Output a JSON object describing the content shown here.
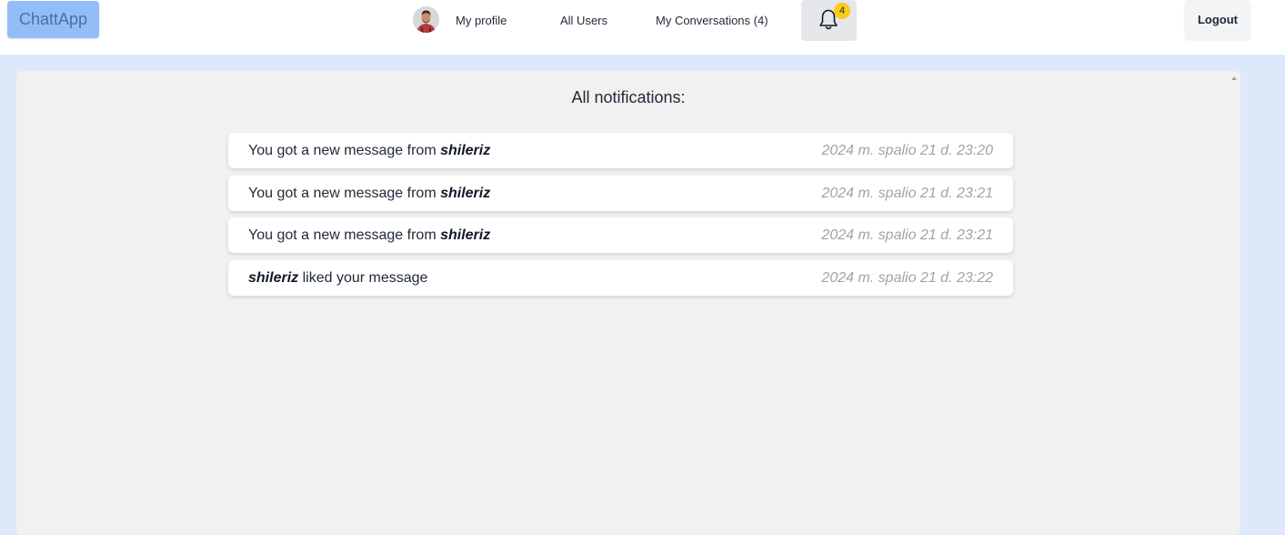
{
  "navbar": {
    "brand": "ChattApp",
    "my_profile": "My profile",
    "all_users": "All Users",
    "my_conversations": "My Conversations (4)",
    "notification_count": "4",
    "logout": "Logout",
    "bell_icon": "bell-icon",
    "avatar_icon": "user-avatar"
  },
  "main": {
    "title": "All notifications:",
    "notifications": [
      {
        "before": "You got a new message from ",
        "user": "shileriz",
        "after": "",
        "time": "2024 m. spalio 21 d. 23:20"
      },
      {
        "before": "You got a new message from ",
        "user": "shileriz",
        "after": "",
        "time": "2024 m. spalio 21 d. 23:21"
      },
      {
        "before": "You got a new message from ",
        "user": "shileriz",
        "after": "",
        "time": "2024 m. spalio 21 d. 23:21"
      },
      {
        "before": "",
        "user": "shileriz",
        "after": " liked your message",
        "time": "2024 m. spalio 21 d. 23:22"
      }
    ]
  },
  "colors": {
    "brand_bg": "#93bdf7",
    "page_bg": "#dde8fb",
    "panel_bg": "#f1f1f1",
    "badge": "#facc15"
  }
}
